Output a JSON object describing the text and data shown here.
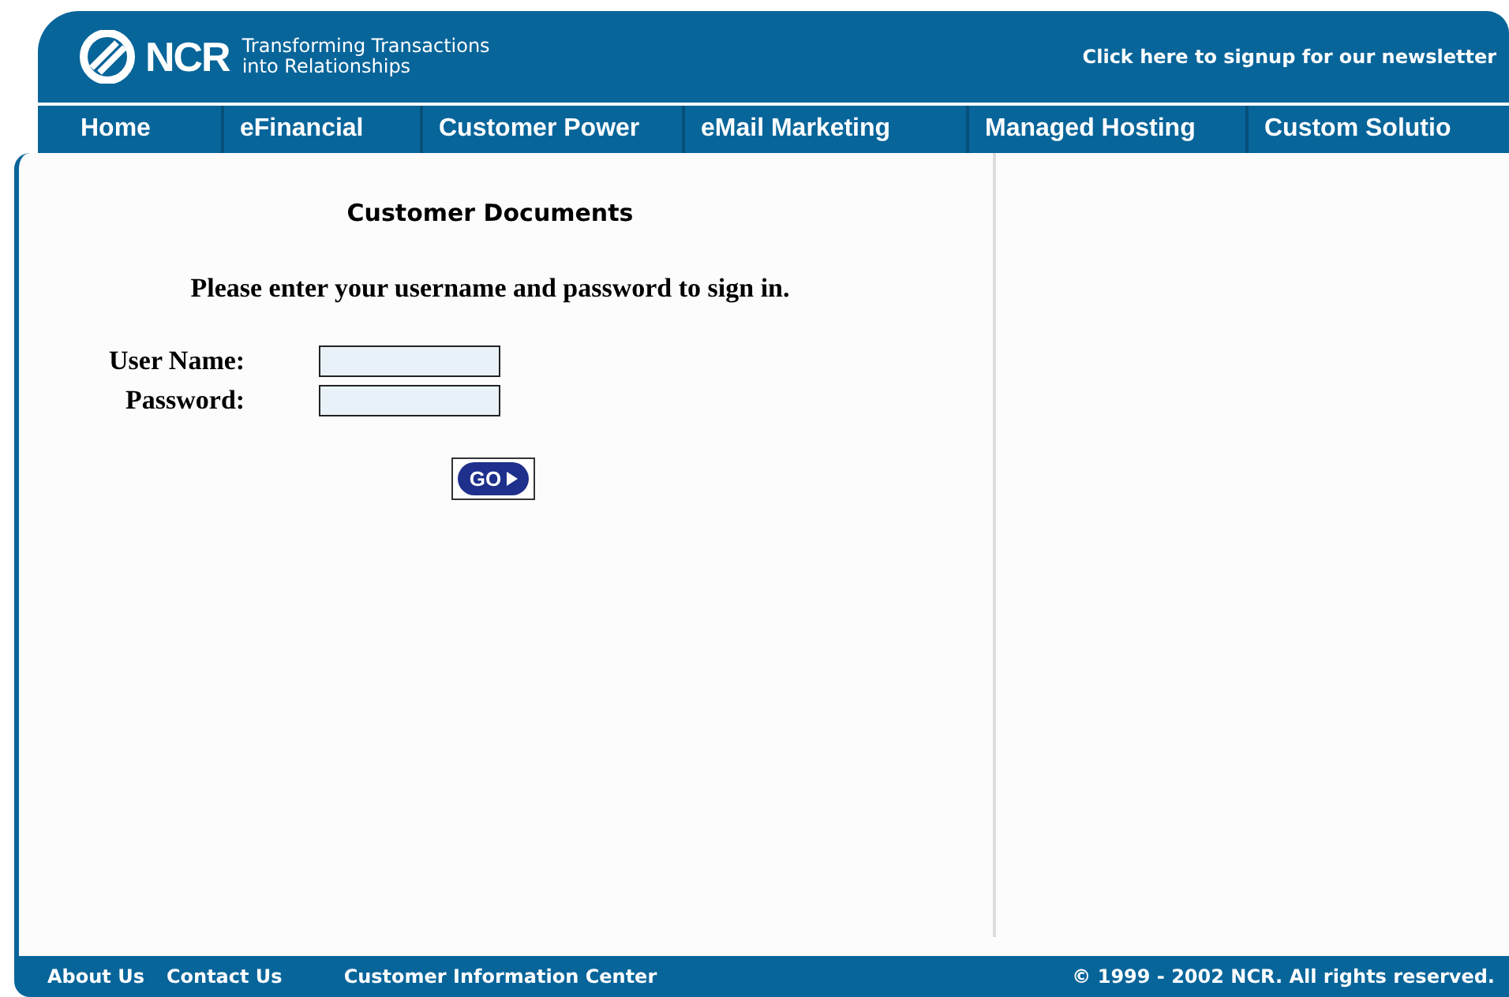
{
  "header": {
    "logo": "NCR",
    "tagline_1": "Transforming Transactions",
    "tagline_2": "into Relationships",
    "newsletter_link": "Click here to signup for our newsletter"
  },
  "nav": [
    {
      "label": "Home"
    },
    {
      "label": "eFinancial"
    },
    {
      "label": "Customer Power"
    },
    {
      "label": "eMail Marketing"
    },
    {
      "label": "Managed Hosting"
    },
    {
      "label": "Custom Solutio"
    }
  ],
  "login": {
    "title": "Customer Documents",
    "instruction": "Please enter your username and password to sign in.",
    "fields": [
      {
        "label": "User Name:"
      },
      {
        "label": "Password:"
      }
    ],
    "button": "GO"
  },
  "footer": {
    "links": [
      "About Us",
      "Contact Us",
      "Customer Information Center"
    ],
    "copyright": "© 1999 - 2002 NCR. All rights reserved."
  }
}
